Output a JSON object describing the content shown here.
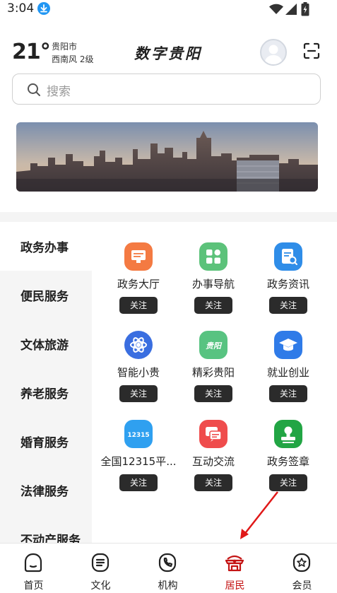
{
  "status_bar": {
    "time": "3:04"
  },
  "header": {
    "temperature": "21°",
    "city": "贵阳市",
    "wind": "西南风  2级",
    "app_title": "数字贵阳"
  },
  "search": {
    "placeholder": "搜索"
  },
  "side_nav": {
    "items": [
      {
        "label": "政务办事",
        "active": true
      },
      {
        "label": "便民服务"
      },
      {
        "label": "文体旅游"
      },
      {
        "label": "养老服务"
      },
      {
        "label": "婚育服务"
      },
      {
        "label": "法律服务"
      },
      {
        "label": "不动产服务"
      }
    ]
  },
  "services": [
    {
      "label": "政务大厅",
      "icon": "hall-screen-icon",
      "color": "#f47a42",
      "button": "关注"
    },
    {
      "label": "办事导航",
      "icon": "navigation-grid-icon",
      "color": "#4cb76c",
      "button": "关注"
    },
    {
      "label": "政务资讯",
      "icon": "news-search-icon",
      "color": "#2f8de8",
      "button": "关注"
    },
    {
      "label": "智能小贵",
      "icon": "ai-atom-icon",
      "color": "#3a6ee0",
      "button": "关注"
    },
    {
      "label": "精彩贵阳",
      "icon": "guiyang-logo-icon",
      "color": "#58c381",
      "button": "关注",
      "icon_text": "贵阳"
    },
    {
      "label": "就业创业",
      "icon": "graduation-cap-icon",
      "color": "#2f7be8",
      "button": "关注"
    },
    {
      "label": "全国12315平...",
      "icon": "12315-icon",
      "color": "#2fa0f0",
      "button": "关注",
      "icon_text": "12315"
    },
    {
      "label": "互动交流",
      "icon": "chat-bubble-icon",
      "color": "#ef4c4c",
      "button": "关注"
    },
    {
      "label": "政务签章",
      "icon": "seal-stamp-icon",
      "color": "#22a544",
      "button": "关注"
    }
  ],
  "bottom_nav": {
    "tabs": [
      {
        "label": "首页",
        "icon": "home-icon"
      },
      {
        "label": "文化",
        "icon": "document-lines-icon"
      },
      {
        "label": "机构",
        "icon": "phone-icon"
      },
      {
        "label": "居民",
        "icon": "residents-icon",
        "active": true
      },
      {
        "label": "会员",
        "icon": "member-star-icon"
      }
    ]
  },
  "colors": {
    "accent_red": "#c41414",
    "button_dark": "#2b2b2b",
    "sidebar_bg": "#f5f5f5"
  }
}
